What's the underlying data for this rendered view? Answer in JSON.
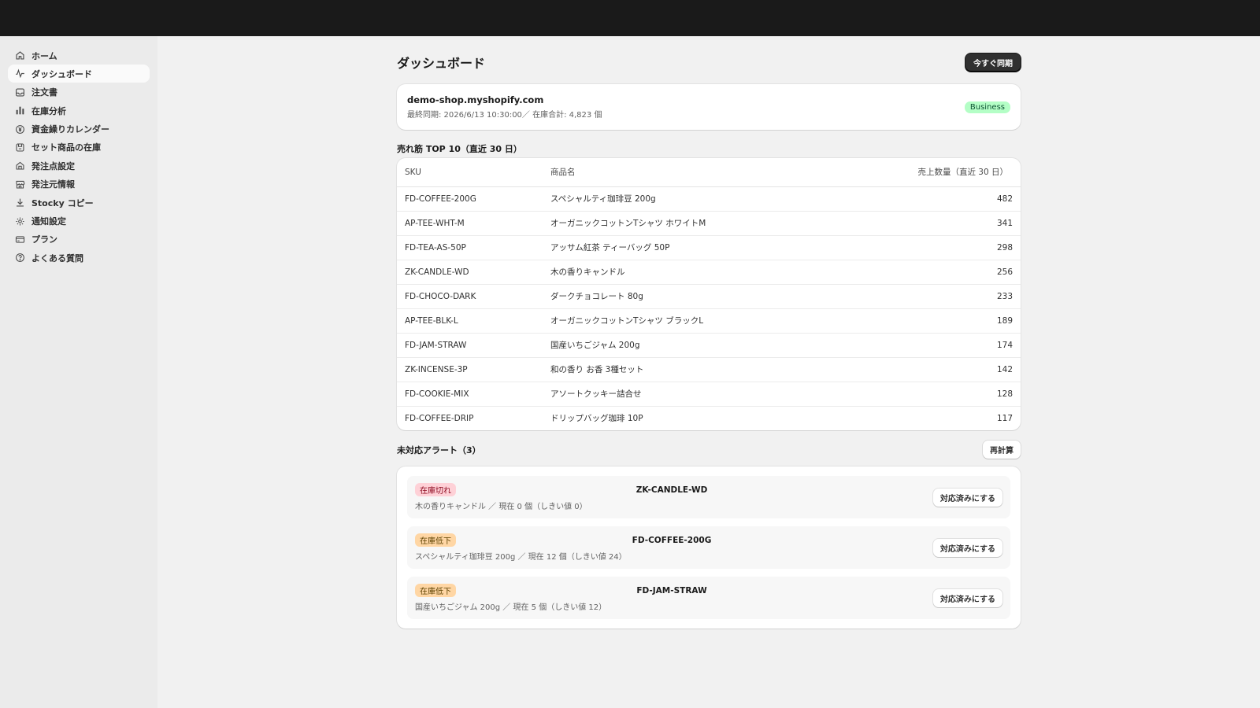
{
  "sidebar": {
    "items": [
      {
        "label": "ホーム",
        "icon": "home-icon"
      },
      {
        "label": "ダッシュボード",
        "icon": "activity-icon",
        "active": true
      },
      {
        "label": "注文書",
        "icon": "inbox-icon"
      },
      {
        "label": "在庫分析",
        "icon": "bar-chart-icon"
      },
      {
        "label": "資金繰りカレンダー",
        "icon": "currency-icon"
      },
      {
        "label": "セット商品の在庫",
        "icon": "bundle-icon"
      },
      {
        "label": "発注点設定",
        "icon": "lock-icon"
      },
      {
        "label": "発注元情報",
        "icon": "store-icon"
      },
      {
        "label": "Stocky コピー",
        "icon": "download-icon"
      },
      {
        "label": "通知設定",
        "icon": "gear-icon"
      },
      {
        "label": "プラン",
        "icon": "credit-card-icon"
      },
      {
        "label": "よくある質問",
        "icon": "question-icon"
      }
    ]
  },
  "header": {
    "title": "ダッシュボード",
    "sync_label": "今すぐ同期"
  },
  "shop": {
    "domain": "demo-shop.myshopify.com",
    "meta": "最終同期: 2026/6/13 10:30:00／ 在庫合計: 4,823 個",
    "plan": "Business"
  },
  "top_sellers": {
    "title": "売れ筋 TOP 10（直近 30 日）",
    "columns": [
      "SKU",
      "商品名",
      "売上数量（直近 30 日）"
    ],
    "rows": [
      {
        "sku": "FD-COFFEE-200G",
        "name": "スペシャルティ珈琲豆 200g",
        "qty": "482"
      },
      {
        "sku": "AP-TEE-WHT-M",
        "name": "オーガニックコットンTシャツ ホワイトM",
        "qty": "341"
      },
      {
        "sku": "FD-TEA-AS-50P",
        "name": "アッサム紅茶 ティーバッグ 50P",
        "qty": "298"
      },
      {
        "sku": "ZK-CANDLE-WD",
        "name": "木の香りキャンドル",
        "qty": "256"
      },
      {
        "sku": "FD-CHOCO-DARK",
        "name": "ダークチョコレート 80g",
        "qty": "233"
      },
      {
        "sku": "AP-TEE-BLK-L",
        "name": "オーガニックコットンTシャツ ブラックL",
        "qty": "189"
      },
      {
        "sku": "FD-JAM-STRAW",
        "name": "国産いちごジャム 200g",
        "qty": "174"
      },
      {
        "sku": "ZK-INCENSE-3P",
        "name": "和の香り お香 3種セット",
        "qty": "142"
      },
      {
        "sku": "FD-COOKIE-MIX",
        "name": "アソートクッキー詰合せ",
        "qty": "128"
      },
      {
        "sku": "FD-COFFEE-DRIP",
        "name": "ドリップバッグ珈琲 10P",
        "qty": "117"
      }
    ]
  },
  "alerts": {
    "title": "未対応アラート（3）",
    "recalc_label": "再計算",
    "items": [
      {
        "badge": "在庫切れ",
        "severity": "critical",
        "sku": "ZK-CANDLE-WD",
        "detail": "木の香りキャンドル ／ 現在 0 個（しきい値 0）",
        "action": "対応済みにする"
      },
      {
        "badge": "在庫低下",
        "severity": "warning",
        "sku": "FD-COFFEE-200G",
        "detail": "スペシャルティ珈琲豆 200g ／ 現在 12 個（しきい値 24）",
        "action": "対応済みにする"
      },
      {
        "badge": "在庫低下",
        "severity": "warning",
        "sku": "FD-JAM-STRAW",
        "detail": "国産いちごジャム 200g ／ 現在 5 個（しきい値 12）",
        "action": "対応済みにする"
      }
    ]
  }
}
